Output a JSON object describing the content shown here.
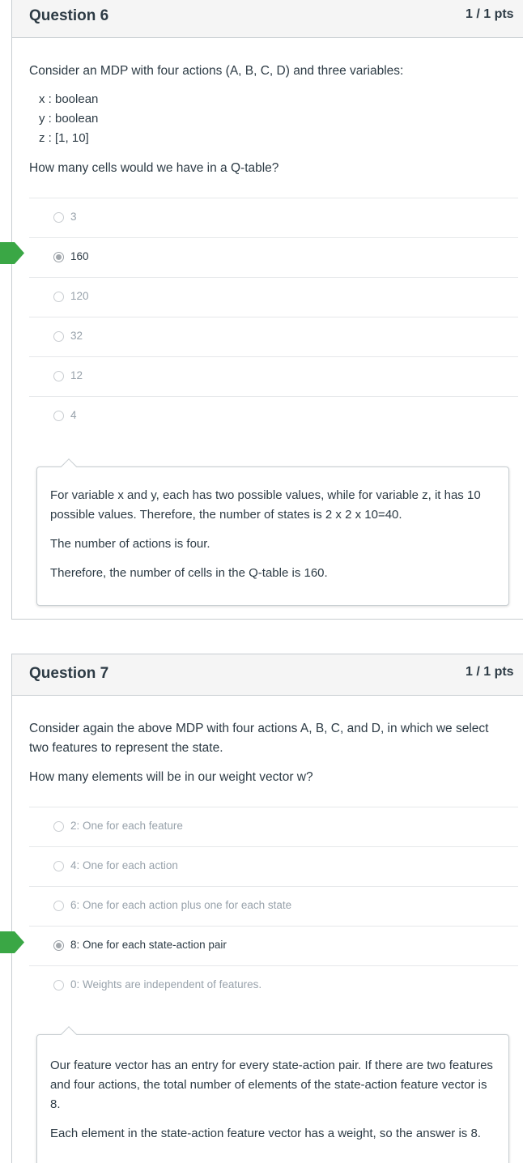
{
  "colors": {
    "correct_arrow": "#3aa745",
    "header_bg": "#f5f5f5",
    "border": "#c7cdd1"
  },
  "q6": {
    "title": "Question 6",
    "points": "1 / 1 pts",
    "prompt": "Consider an MDP with four actions (A, B, C, D) and three variables:",
    "vars": [
      "x : boolean",
      "y : boolean",
      "z : [1, 10]"
    ],
    "question": "How many cells would we have in a Q-table?",
    "answers": [
      {
        "label": "3",
        "selected": false
      },
      {
        "label": "160",
        "selected": true
      },
      {
        "label": "120",
        "selected": false
      },
      {
        "label": "32",
        "selected": false
      },
      {
        "label": "12",
        "selected": false
      },
      {
        "label": "4",
        "selected": false
      }
    ],
    "comment": [
      "For variable x and y, each has two possible values, while for variable z, it has 10 possible values. Therefore, the number of states is 2 x 2 x 10=40.",
      "The number of actions is four.",
      "Therefore, the number of cells in the Q-table is 160."
    ]
  },
  "q7": {
    "title": "Question 7",
    "points": "1 / 1 pts",
    "prompt": "Consider again the above MDP with four actions A, B, C, and D, in which we select two features to represent the state.",
    "question": "How many elements will be in our weight vector w?",
    "answers": [
      {
        "label": "2: One for each feature",
        "selected": false
      },
      {
        "label": "4: One for each action",
        "selected": false
      },
      {
        "label": "6: One for each action plus one for each state",
        "selected": false
      },
      {
        "label": "8: One for each state-action pair",
        "selected": true
      },
      {
        "label": "0: Weights are independent of features.",
        "selected": false
      }
    ],
    "comment": [
      "Our feature vector has an entry for every state-action pair. If there are two features and four actions, the total number of elements of the state-action feature vector is 8.",
      "Each element in the state-action feature vector has a weight, so the answer is 8."
    ]
  }
}
